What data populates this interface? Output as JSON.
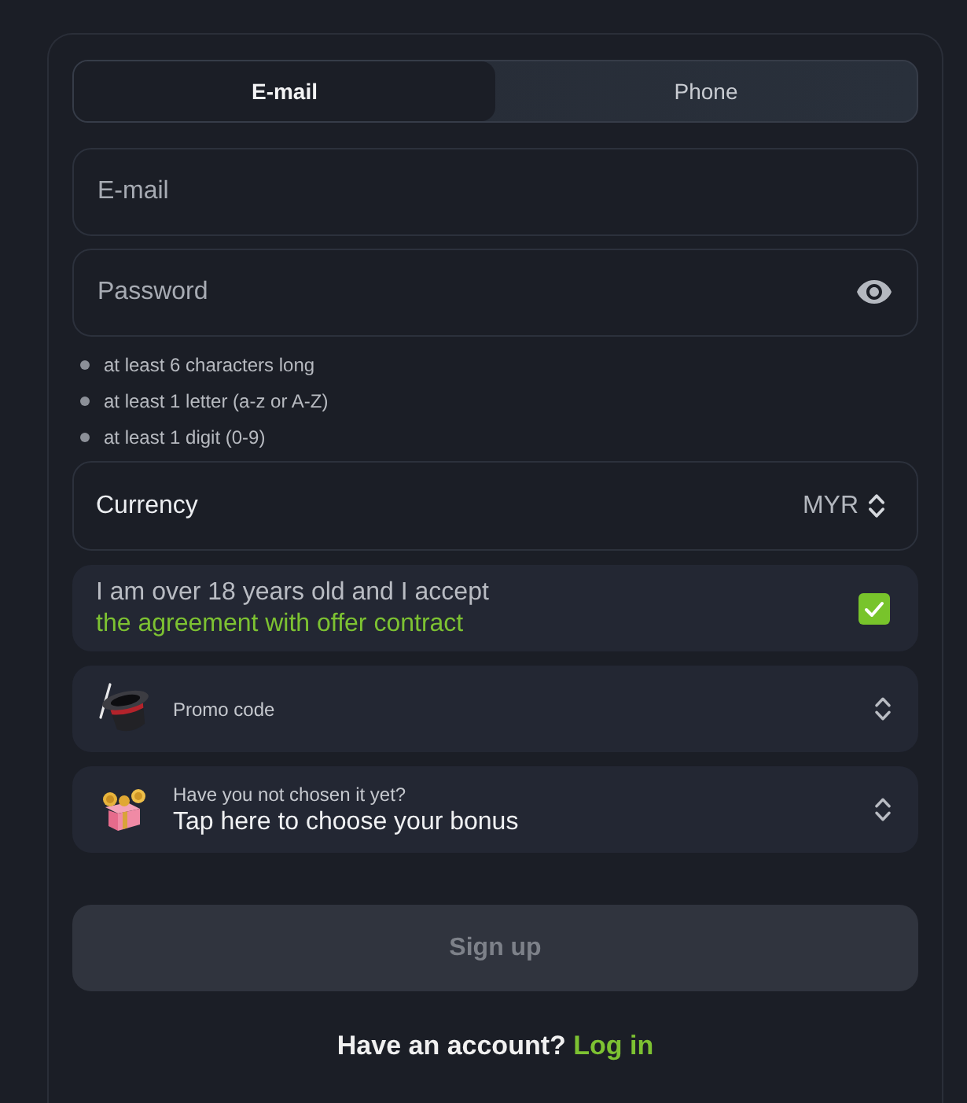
{
  "tabs": [
    {
      "label": "E-mail",
      "selected": true
    },
    {
      "label": "Phone",
      "selected": false
    }
  ],
  "email_field": {
    "placeholder": "E-mail"
  },
  "password_field": {
    "placeholder": "Password"
  },
  "password_rules": [
    "at least 6 characters long",
    "at least 1 letter (a-z or A-Z)",
    "at least 1 digit (0-9)"
  ],
  "currency": {
    "label": "Currency",
    "value": "MYR"
  },
  "agreement": {
    "text": "I am over 18 years old and I accept",
    "link": "the agreement with offer contract",
    "checked": true
  },
  "promo": {
    "label": "Promo code"
  },
  "bonus": {
    "hint": "Have you not chosen it yet?",
    "label": "Tap here to choose your bonus"
  },
  "sign_up": {
    "label": "Sign up",
    "disabled": true
  },
  "login_prompt": {
    "text": "Have an account?",
    "link": "Log in"
  }
}
